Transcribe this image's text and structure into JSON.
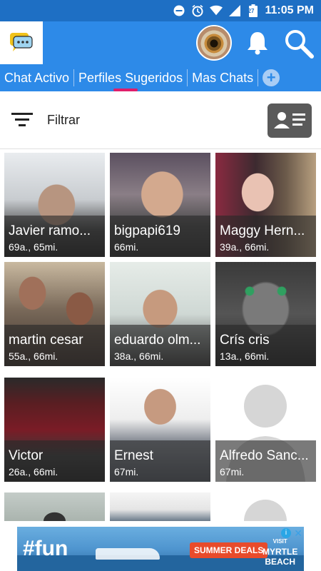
{
  "statusbar": {
    "time": "11:05 PM",
    "battery_label": "27"
  },
  "appbar": {
    "logo_icon": "chat-bubbles-icon",
    "avatar_icon": "eye-avatar",
    "bell_icon": "bell-icon",
    "search_icon": "search-icon"
  },
  "tabs": [
    {
      "label": "Chat Activo"
    },
    {
      "label": "Perfiles Sugeridos",
      "active": true
    },
    {
      "label": "Mas Chats"
    }
  ],
  "tab_add": "+",
  "filter": {
    "label": "Filtrar",
    "sort_icon": "sort-lines-icon",
    "contact_card_icon": "contact-card-icon"
  },
  "profiles": [
    {
      "name": "Javier ramo...",
      "meta": "69a., 65mi."
    },
    {
      "name": "bigpapi619",
      "meta": "66mi."
    },
    {
      "name": "Maggy Hern...",
      "meta": "39a., 66mi."
    },
    {
      "name": "martin cesar",
      "meta": "55a., 66mi."
    },
    {
      "name": "eduardo olm...",
      "meta": "38a., 66mi."
    },
    {
      "name": "Crís cris",
      "meta": "13a., 66mi."
    },
    {
      "name": "Victor",
      "meta": "26a., 66mi."
    },
    {
      "name": "Ernest",
      "meta": "67mi."
    },
    {
      "name": "Alfredo Sanc...",
      "meta": "67mi."
    }
  ],
  "ad": {
    "headline": "#fun",
    "deal": "SUMMER DEALS",
    "dest_line1": "VISIT",
    "dest_line2": "MYRTLE",
    "dest_line3": "BEACH"
  }
}
